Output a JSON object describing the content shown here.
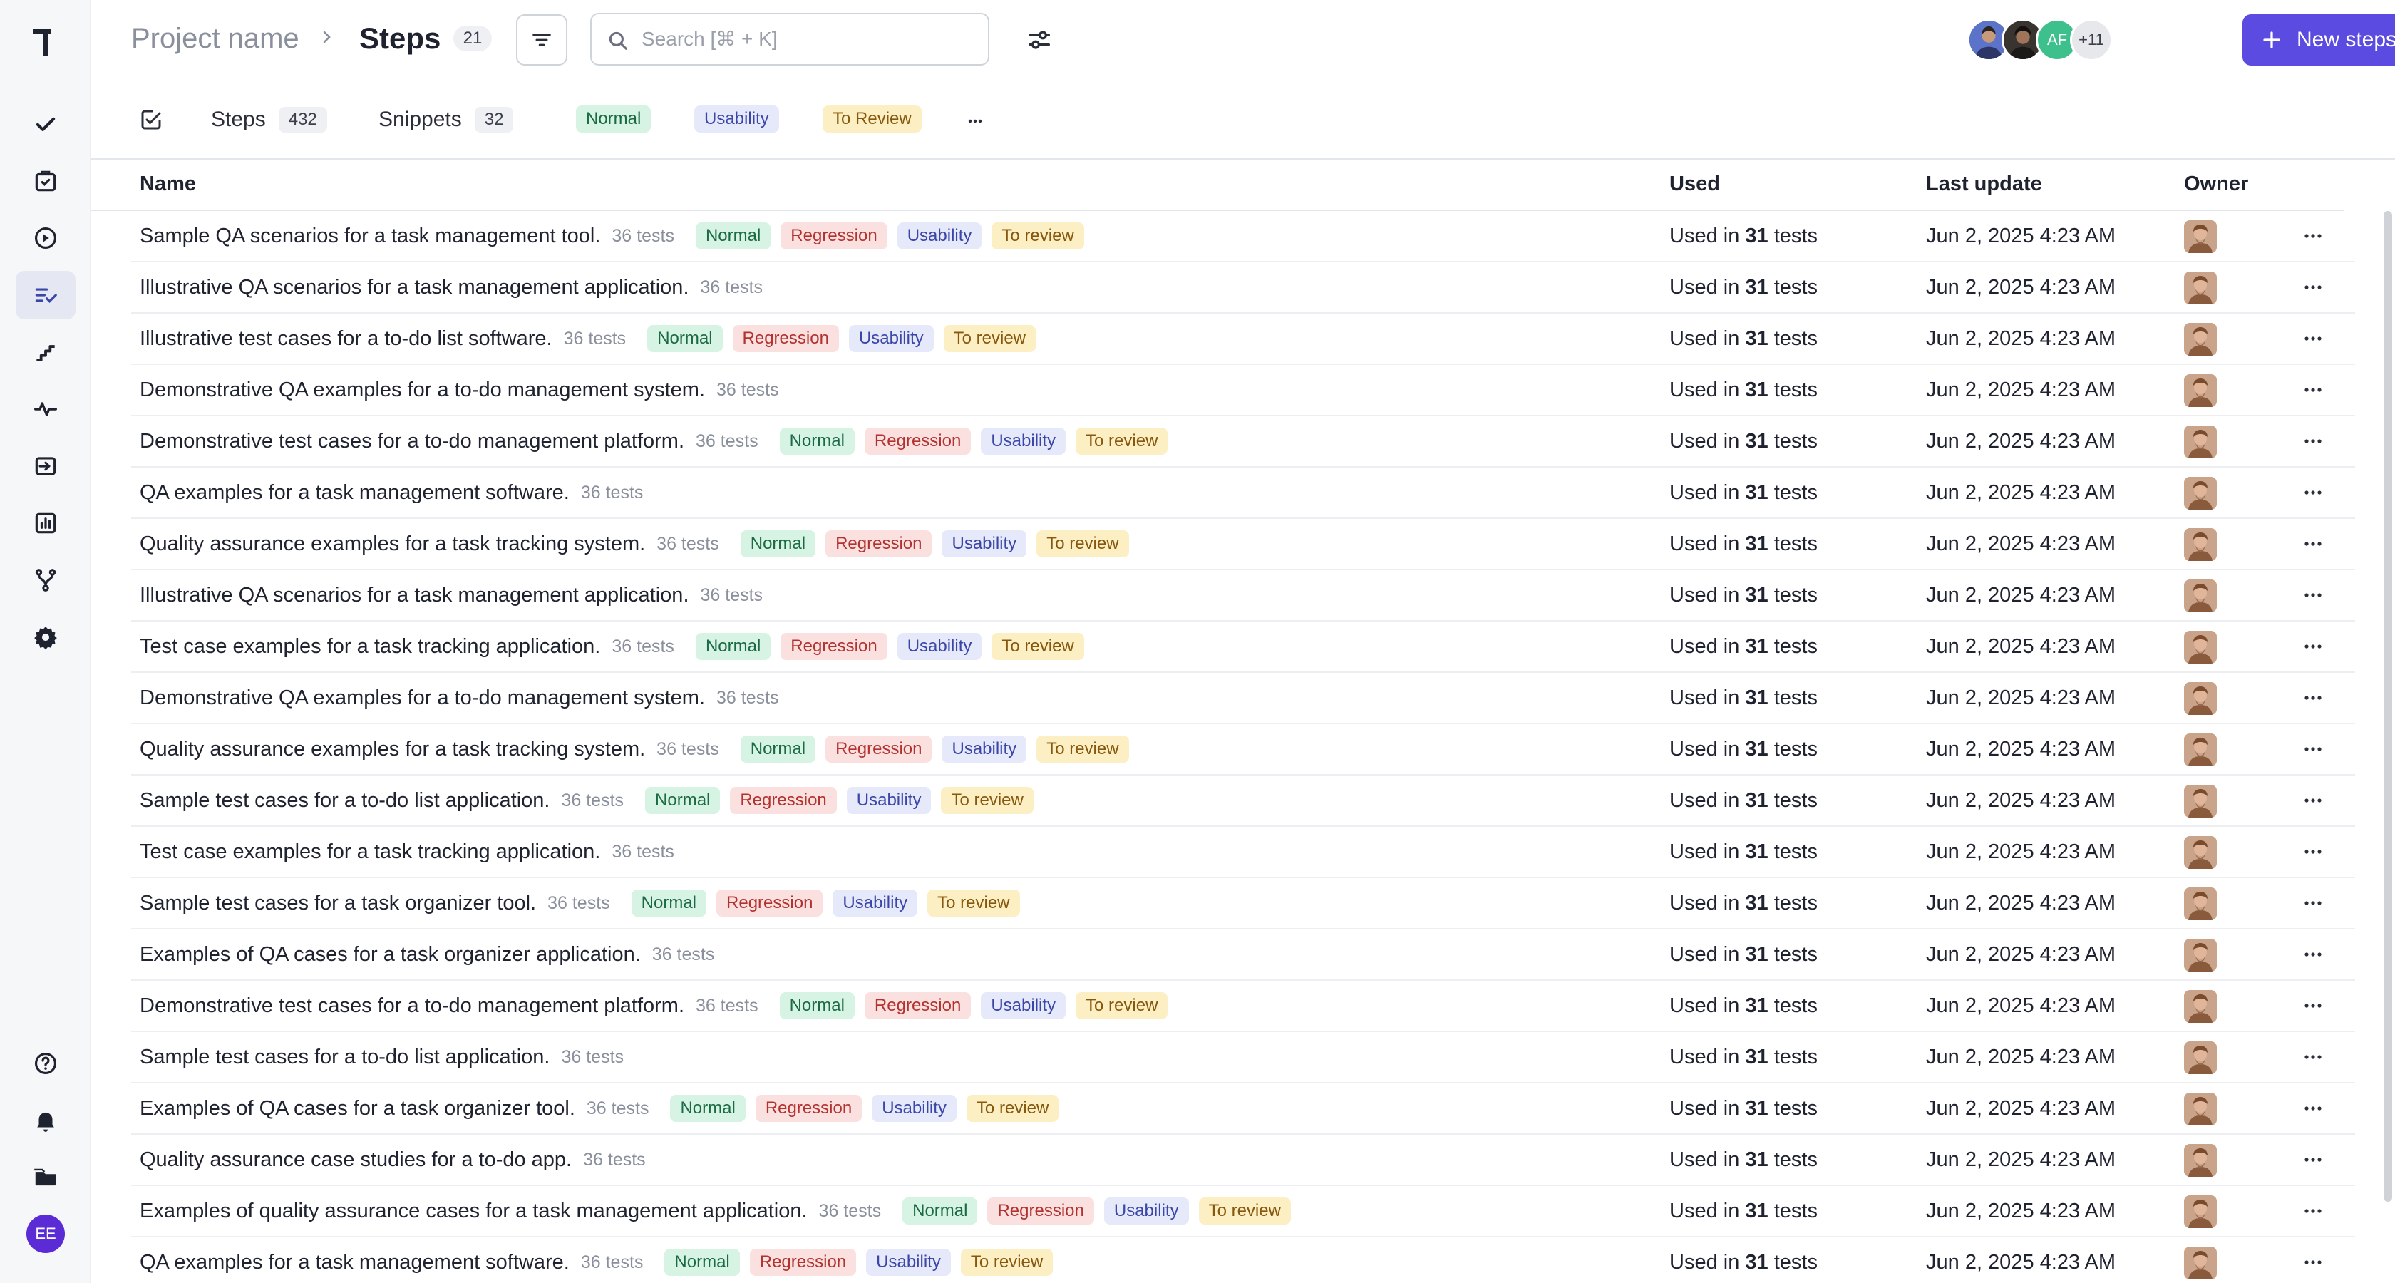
{
  "sidebar": {
    "logo": "T",
    "items": [
      {
        "icon": "check-icon",
        "name": "sidebar-item-check"
      },
      {
        "icon": "clipboard-icon",
        "name": "sidebar-item-clipboard"
      },
      {
        "icon": "play-icon",
        "name": "sidebar-item-runs"
      },
      {
        "icon": "steps-icon",
        "name": "sidebar-item-steps",
        "active": true
      },
      {
        "icon": "stairs-icon",
        "name": "sidebar-item-stairs"
      },
      {
        "icon": "activity-icon",
        "name": "sidebar-item-activity"
      },
      {
        "icon": "import-icon",
        "name": "sidebar-item-import"
      },
      {
        "icon": "bar-chart-icon",
        "name": "sidebar-item-reports"
      },
      {
        "icon": "branch-icon",
        "name": "sidebar-item-branches"
      },
      {
        "icon": "gear-icon",
        "name": "sidebar-item-settings"
      },
      {
        "icon": "help-icon",
        "name": "sidebar-item-help"
      },
      {
        "icon": "bell-icon",
        "name": "sidebar-item-notifications"
      },
      {
        "icon": "folder-icon",
        "name": "sidebar-item-folders"
      }
    ],
    "user_initials": "EE",
    "user_color": "#5b2bd6"
  },
  "header": {
    "project": "Project name",
    "title": "Steps",
    "title_count": "21",
    "search_placeholder": "Search [⌘ + K]",
    "collaborators": [
      {
        "kind": "photo",
        "color": "#3d4a8a"
      },
      {
        "kind": "photo",
        "color": "#2a2420"
      },
      {
        "kind": "initials",
        "text": "AF",
        "color": "#3dc08c"
      }
    ],
    "more_collaborators": "+11",
    "new_button": "New steps",
    "accent": "#5b4be0"
  },
  "tabs": {
    "steps_label": "Steps",
    "steps_count": "432",
    "snippets_label": "Snippets",
    "snippets_count": "32",
    "filters": [
      "Normal",
      "Usability",
      "To Review"
    ]
  },
  "table": {
    "columns": {
      "name": "Name",
      "used": "Used",
      "last_update": "Last update",
      "owner": "Owner"
    },
    "used_prefix": "Used in ",
    "used_count": "31",
    "used_suffix": " tests",
    "rows": [
      {
        "name": "Sample QA scenarios for a task management tool.",
        "tests": "36 tests",
        "tags": true,
        "date": "Jun 2, 2025 4:23 AM"
      },
      {
        "name": "Illustrative QA scenarios for a task management application.",
        "tests": "36 tests",
        "tags": false,
        "date": "Jun 2, 2025 4:23 AM"
      },
      {
        "name": "Illustrative test cases for a to-do list software.",
        "tests": "36 tests",
        "tags": true,
        "date": "Jun 2, 2025 4:23 AM"
      },
      {
        "name": "Demonstrative QA examples for a to-do management system.",
        "tests": "36 tests",
        "tags": false,
        "date": "Jun 2, 2025 4:23 AM"
      },
      {
        "name": "Demonstrative test cases for a to-do management platform.",
        "tests": "36 tests",
        "tags": true,
        "date": "Jun 2, 2025 4:23 AM"
      },
      {
        "name": "QA examples for a task management software.",
        "tests": "36 tests",
        "tags": false,
        "date": "Jun 2, 2025 4:23 AM"
      },
      {
        "name": "Quality assurance examples for a task tracking system.",
        "tests": "36 tests",
        "tags": true,
        "date": "Jun 2, 2025 4:23 AM"
      },
      {
        "name": "Illustrative QA scenarios for a task management application.",
        "tests": "36 tests",
        "tags": false,
        "date": "Jun 2, 2025 4:23 AM"
      },
      {
        "name": "Test case examples for a task tracking application.",
        "tests": "36 tests",
        "tags": true,
        "date": "Jun 2, 2025 4:23 AM"
      },
      {
        "name": "Demonstrative QA examples for a to-do management system.",
        "tests": "36 tests",
        "tags": false,
        "date": "Jun 2, 2025 4:23 AM"
      },
      {
        "name": "Quality assurance examples for a task tracking system.",
        "tests": "36 tests",
        "tags": true,
        "date": "Jun 2, 2025 4:23 AM"
      },
      {
        "name": "Sample test cases for a to-do list application.",
        "tests": "36 tests",
        "tags": true,
        "date": "Jun 2, 2025 4:23 AM"
      },
      {
        "name": "Test case examples for a task tracking application.",
        "tests": "36 tests",
        "tags": false,
        "date": "Jun 2, 2025 4:23 AM"
      },
      {
        "name": "Sample test cases for a task organizer tool.",
        "tests": "36 tests",
        "tags": true,
        "date": "Jun 2, 2025 4:23 AM"
      },
      {
        "name": "Examples of QA cases for a task organizer application.",
        "tests": "36 tests",
        "tags": false,
        "date": "Jun 2, 2025 4:23 AM"
      },
      {
        "name": "Demonstrative test cases for a to-do management platform.",
        "tests": "36 tests",
        "tags": true,
        "date": "Jun 2, 2025 4:23 AM"
      },
      {
        "name": "Sample test cases for a to-do list application.",
        "tests": "36 tests",
        "tags": false,
        "date": "Jun 2, 2025 4:23 AM"
      },
      {
        "name": "Examples of QA cases for a task organizer tool.",
        "tests": "36 tests",
        "tags": true,
        "date": "Jun 2, 2025 4:23 AM"
      },
      {
        "name": "Quality assurance case studies for a to-do app.",
        "tests": "36 tests",
        "tags": false,
        "date": "Jun 2, 2025 4:23 AM"
      },
      {
        "name": "Examples of quality assurance cases for a task management application.",
        "tests": "36 tests",
        "tags": true,
        "date": "Jun 2, 2025 4:23 AM"
      },
      {
        "name": "QA examples for a task management software.",
        "tests": "36 tests",
        "tags": true,
        "date": "Jun 2, 2025 4:23 AM"
      }
    ],
    "row_tags": [
      {
        "label": "Normal",
        "kind": "normal"
      },
      {
        "label": "Regression",
        "kind": "regression"
      },
      {
        "label": "Usability",
        "kind": "usability"
      },
      {
        "label": "To review",
        "kind": "review"
      }
    ]
  }
}
